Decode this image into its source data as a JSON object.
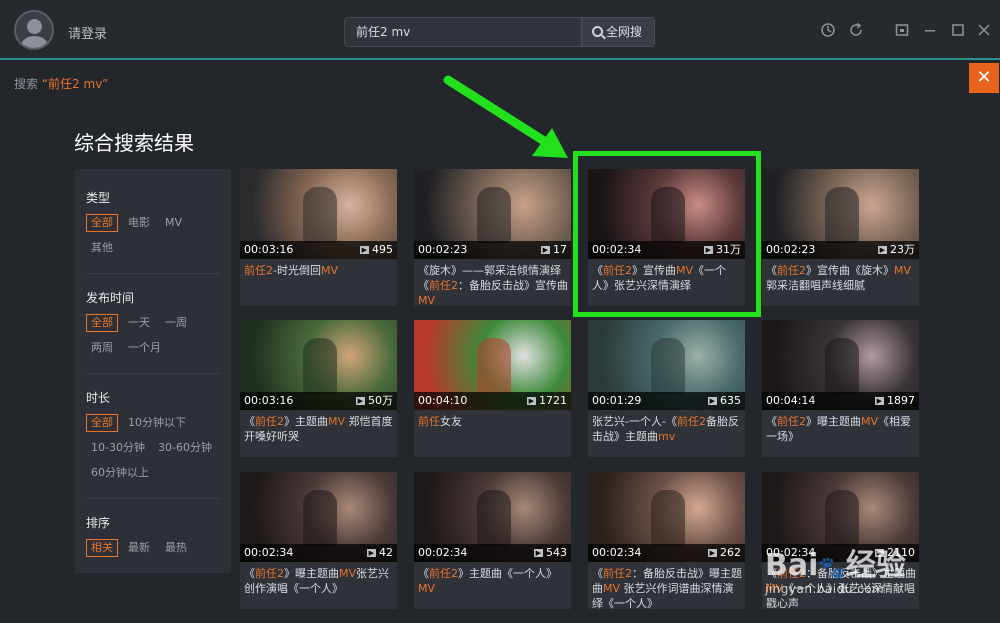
{
  "header": {
    "login_label": "请登录",
    "search_value": "前任2 mv",
    "search_button_label": "全网搜"
  },
  "breadcrumb": {
    "prefix": "搜索",
    "query": "“前任2 mv”"
  },
  "page_title": "综合搜索结果",
  "filters": {
    "type": {
      "title": "类型",
      "options": [
        "全部",
        "电影",
        "MV",
        "其他"
      ],
      "selected": "全部"
    },
    "time": {
      "title": "发布时间",
      "options": [
        "全部",
        "一天",
        "一周",
        "两周",
        "一个月"
      ],
      "selected": "全部"
    },
    "duration": {
      "title": "时长",
      "options": [
        "全部",
        "10分钟以下",
        "10-30分钟",
        "30-60分钟",
        "60分钟以上"
      ],
      "selected": "全部"
    },
    "sort": {
      "title": "排序",
      "options": [
        "相关",
        "最新",
        "最热"
      ],
      "selected": "相关"
    }
  },
  "results": [
    {
      "duration": "00:03:16",
      "count": "495",
      "title_parts": [
        {
          "t": "前任2",
          "hl": true
        },
        {
          "t": "-时光倒回",
          "hl": false
        },
        {
          "t": "MV",
          "hl": true
        }
      ],
      "thumb_colors": [
        "#8a6a55",
        "#d6b3a0",
        "#2b2b2e"
      ]
    },
    {
      "duration": "00:02:23",
      "count": "17",
      "title_parts": [
        {
          "t": "《旋木》——郭采洁倾情演绎《",
          "hl": false
        },
        {
          "t": "前任2",
          "hl": true
        },
        {
          "t": "：备胎反击战》宣传曲",
          "hl": false
        },
        {
          "t": "MV",
          "hl": true
        }
      ],
      "thumb_colors": [
        "#7b6657",
        "#c9a18a",
        "#1f2024"
      ]
    },
    {
      "duration": "00:02:34",
      "count": "31万",
      "title_parts": [
        {
          "t": "《",
          "hl": false
        },
        {
          "t": "前任2",
          "hl": true
        },
        {
          "t": "》宣传曲",
          "hl": false
        },
        {
          "t": "MV",
          "hl": true
        },
        {
          "t": "《一个人》张艺兴深情演绎",
          "hl": false
        }
      ],
      "thumb_colors": [
        "#5d3a3b",
        "#c98d86",
        "#1a1416"
      ]
    },
    {
      "duration": "00:02:23",
      "count": "23万",
      "title_parts": [
        {
          "t": "《",
          "hl": false
        },
        {
          "t": "前任2",
          "hl": true
        },
        {
          "t": "》宣传曲《旋木》",
          "hl": false
        },
        {
          "t": "MV",
          "hl": true
        },
        {
          "t": "郭采洁翻唱声线细腻",
          "hl": false
        }
      ],
      "thumb_colors": [
        "#7b6657",
        "#cba592",
        "#1f2024"
      ]
    },
    {
      "duration": "00:03:16",
      "count": "50万",
      "title_parts": [
        {
          "t": "《",
          "hl": false
        },
        {
          "t": "前任2",
          "hl": true
        },
        {
          "t": "》主题曲",
          "hl": false
        },
        {
          "t": "MV",
          "hl": true
        },
        {
          "t": " 郑恺首度开嗓好听哭",
          "hl": false
        }
      ],
      "thumb_colors": [
        "#4a6a3a",
        "#d0a57a",
        "#203020"
      ]
    },
    {
      "duration": "00:04:10",
      "count": "1721",
      "title_parts": [
        {
          "t": "前任",
          "hl": true
        },
        {
          "t": "女友",
          "hl": false
        }
      ],
      "thumb_colors": [
        "#3c8a3a",
        "#e0e0e0",
        "#b83a2a"
      ]
    },
    {
      "duration": "00:01:29",
      "count": "635",
      "title_parts": [
        {
          "t": "张艺兴-一个人-《",
          "hl": false
        },
        {
          "t": "前任2",
          "hl": true
        },
        {
          "t": "备胎反击战》主题曲",
          "hl": false
        },
        {
          "t": "mv",
          "hl": true
        }
      ],
      "thumb_colors": [
        "#4a6a6a",
        "#9bb0a8",
        "#2a3a3a"
      ]
    },
    {
      "duration": "00:04:14",
      "count": "1897",
      "title_parts": [
        {
          "t": "《",
          "hl": false
        },
        {
          "t": "前任2",
          "hl": true
        },
        {
          "t": "》曝主题曲",
          "hl": false
        },
        {
          "t": "MV",
          "hl": true
        },
        {
          "t": "《相爱一场》",
          "hl": false
        }
      ],
      "thumb_colors": [
        "#3a3438",
        "#b09aa0",
        "#1c181a"
      ]
    },
    {
      "duration": "00:02:34",
      "count": "42",
      "title_parts": [
        {
          "t": "《",
          "hl": false
        },
        {
          "t": "前任2",
          "hl": true
        },
        {
          "t": "》曝主题曲",
          "hl": false
        },
        {
          "t": "MV",
          "hl": true
        },
        {
          "t": "张艺兴创作演唱《一个人》",
          "hl": false
        }
      ],
      "thumb_colors": [
        "#4a3a38",
        "#a88878",
        "#1e1818"
      ]
    },
    {
      "duration": "00:02:34",
      "count": "543",
      "title_parts": [
        {
          "t": "《",
          "hl": false
        },
        {
          "t": "前任2",
          "hl": true
        },
        {
          "t": "》主题曲《一个人》",
          "hl": false
        },
        {
          "t": "MV",
          "hl": true
        }
      ],
      "thumb_colors": [
        "#4a3a38",
        "#a88878",
        "#1e1818"
      ]
    },
    {
      "duration": "00:02:34",
      "count": "262",
      "title_parts": [
        {
          "t": "《",
          "hl": false
        },
        {
          "t": "前任2",
          "hl": true
        },
        {
          "t": "：备胎反击战》曝主题曲",
          "hl": false
        },
        {
          "t": "MV",
          "hl": true
        },
        {
          "t": " 张艺兴作词谱曲深情演绎《一个人》",
          "hl": false
        }
      ],
      "thumb_colors": [
        "#6a5048",
        "#d4a890",
        "#2a201c"
      ]
    },
    {
      "duration": "00:02:34",
      "count": "2110",
      "title_parts": [
        {
          "t": "《",
          "hl": false
        },
        {
          "t": "前任2",
          "hl": true
        },
        {
          "t": "：备胎反击战》主题曲",
          "hl": false
        },
        {
          "t": "MV",
          "hl": true
        },
        {
          "t": "《一个人》张艺兴深情献唱戳心声",
          "hl": false
        }
      ],
      "thumb_colors": [
        "#4a3a38",
        "#a88878",
        "#1e1818"
      ]
    }
  ],
  "watermark": {
    "brand": "Bai",
    "brand2": "经验",
    "url": "jingyan.baidu.com"
  },
  "colors": {
    "accent": "#e8742c",
    "highlight": "#22e01b",
    "teal_rule": "#2a8f8a"
  }
}
